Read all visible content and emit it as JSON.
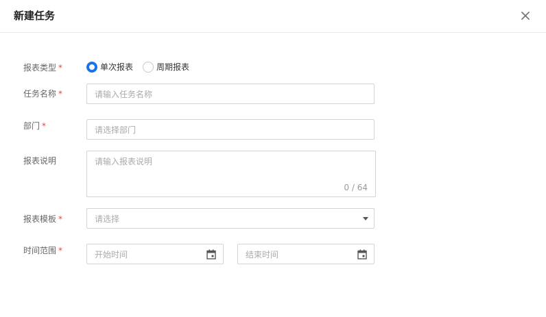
{
  "dialog": {
    "title": "新建任务",
    "close_icon": "close-icon"
  },
  "form": {
    "report_type": {
      "label": "报表类型",
      "required_mark": "*",
      "options": [
        {
          "label": "单次报表",
          "checked": true
        },
        {
          "label": "周期报表",
          "checked": false
        }
      ]
    },
    "task_name": {
      "label": "任务名称",
      "required_mark": "*",
      "placeholder": "请输入任务名称",
      "value": ""
    },
    "department": {
      "label": "部门",
      "required_mark": "*",
      "placeholder": "请选择部门",
      "value": ""
    },
    "description": {
      "label": "报表说明",
      "placeholder": "请输入报表说明",
      "value": "",
      "counter": "0 / 64"
    },
    "template": {
      "label": "报表模板",
      "required_mark": "*",
      "placeholder": "请选择",
      "icon": "chevron-down-icon"
    },
    "time_range": {
      "label": "时间范围",
      "required_mark": "*",
      "start_placeholder": "开始时间",
      "end_placeholder": "结束时间",
      "icon": "calendar-icon"
    }
  },
  "colors": {
    "primary": "#1a73e8",
    "required": "#e54545",
    "border": "#d4d4d4",
    "placeholder": "#aaaaaa"
  }
}
